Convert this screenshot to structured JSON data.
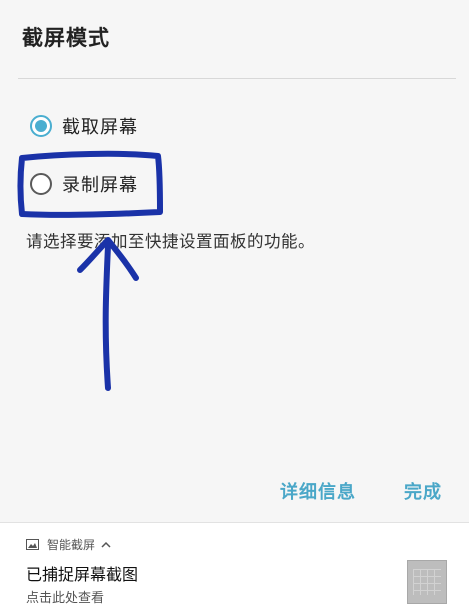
{
  "dialog": {
    "title": "截屏模式",
    "options": [
      {
        "label": "截取屏幕",
        "selected": true
      },
      {
        "label": "录制屏幕",
        "selected": false
      }
    ],
    "description": "请选择要添加至快捷设置面板的功能。",
    "details_label": "详细信息",
    "done_label": "完成"
  },
  "notification": {
    "app_name": "智能截屏",
    "title": "已捕捉屏幕截图",
    "subtitle": "点击此处查看"
  },
  "colors": {
    "accent": "#4aaed0",
    "annotation": "#1a32a8"
  }
}
